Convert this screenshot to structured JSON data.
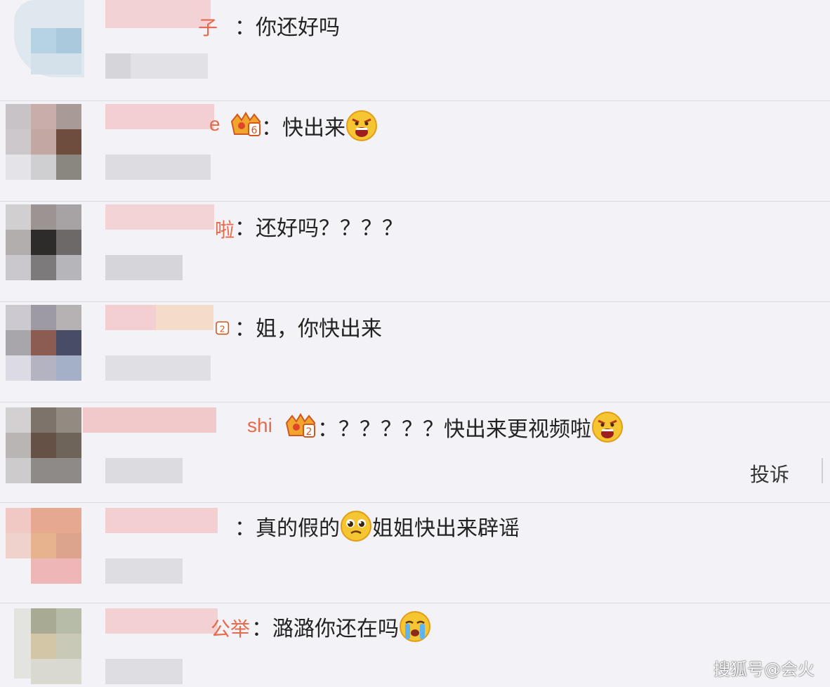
{
  "comments": [
    {
      "nick_suffix": "子",
      "separator": "：",
      "text": "你还好吗",
      "badge": null,
      "emoji_after": null
    },
    {
      "nick_suffix": "e",
      "separator": "：",
      "text": "快出来",
      "badge": "6",
      "emoji_after": "angry-face"
    },
    {
      "nick_suffix": "啦",
      "separator": "：",
      "text": "还好吗？？？？",
      "badge": null,
      "emoji_after": null
    },
    {
      "nick_suffix": "",
      "separator": "：",
      "text": "姐，你快出来",
      "badge": "2",
      "emoji_after": null
    },
    {
      "nick_suffix": "shi",
      "separator": "：",
      "text": "？？？？？快出来更视频啦",
      "badge": "2",
      "emoji_after": "angry-face",
      "report": "投诉"
    },
    {
      "nick_suffix": "",
      "separator": "：",
      "text_before": "真的假的",
      "emoji_mid": "pleading-face",
      "text_after": "姐姐快出来辟谣"
    },
    {
      "nick_suffix": "公举",
      "separator": "：",
      "text": "潞潞你还在吗",
      "badge": null,
      "emoji_after": "crying-face"
    }
  ],
  "watermark": "搜狐号@会火",
  "colors": {
    "nick": "#e86a4c",
    "badge": "#f0a62c",
    "divider": "#dcdbe0",
    "background": "#f3f2f6"
  }
}
